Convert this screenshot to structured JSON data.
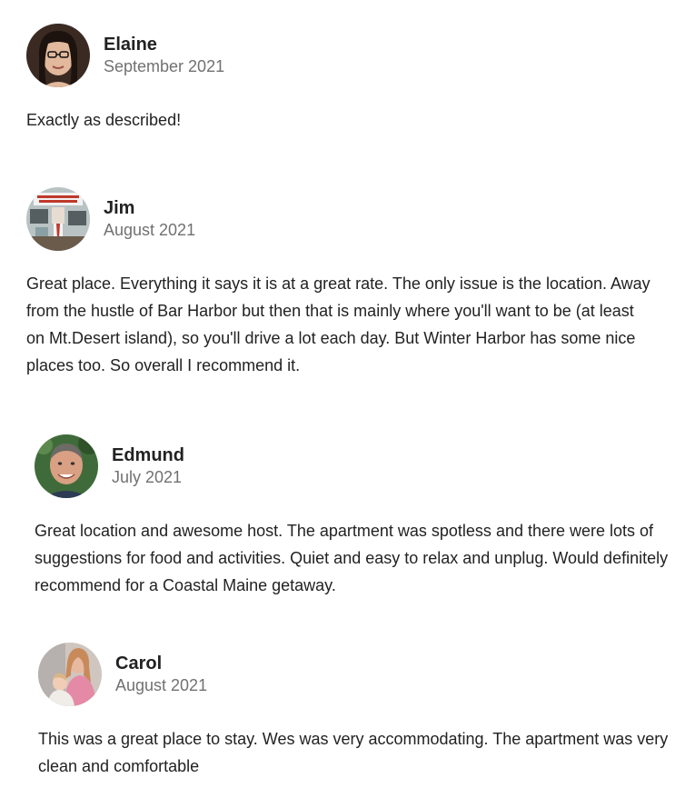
{
  "reviews": [
    {
      "name": "Elaine",
      "date": "September 2021",
      "text": "Exactly as described!"
    },
    {
      "name": "Jim",
      "date": "August 2021",
      "text": "Great place. Everything it says it is at a great rate. The only issue is the location. Away from the hustle of Bar Harbor but then that is mainly where you'll want to be (at least on Mt.Desert island), so you'll drive a lot each day. But Winter Harbor has some nice places too. So overall I recommend it."
    },
    {
      "name": "Edmund",
      "date": "July 2021",
      "text": "Great location and awesome host. The apartment was spotless and there were lots of suggestions for food and activities. Quiet and easy to relax and unplug. Would definitely recommend for a Coastal Maine getaway."
    },
    {
      "name": "Carol",
      "date": "August 2021",
      "text": "This was a great place to stay. Wes was very accommodating. The apartment was very clean and comfortable"
    }
  ],
  "colors": {
    "text_primary": "#222222",
    "text_secondary": "#717171",
    "background": "#ffffff"
  }
}
